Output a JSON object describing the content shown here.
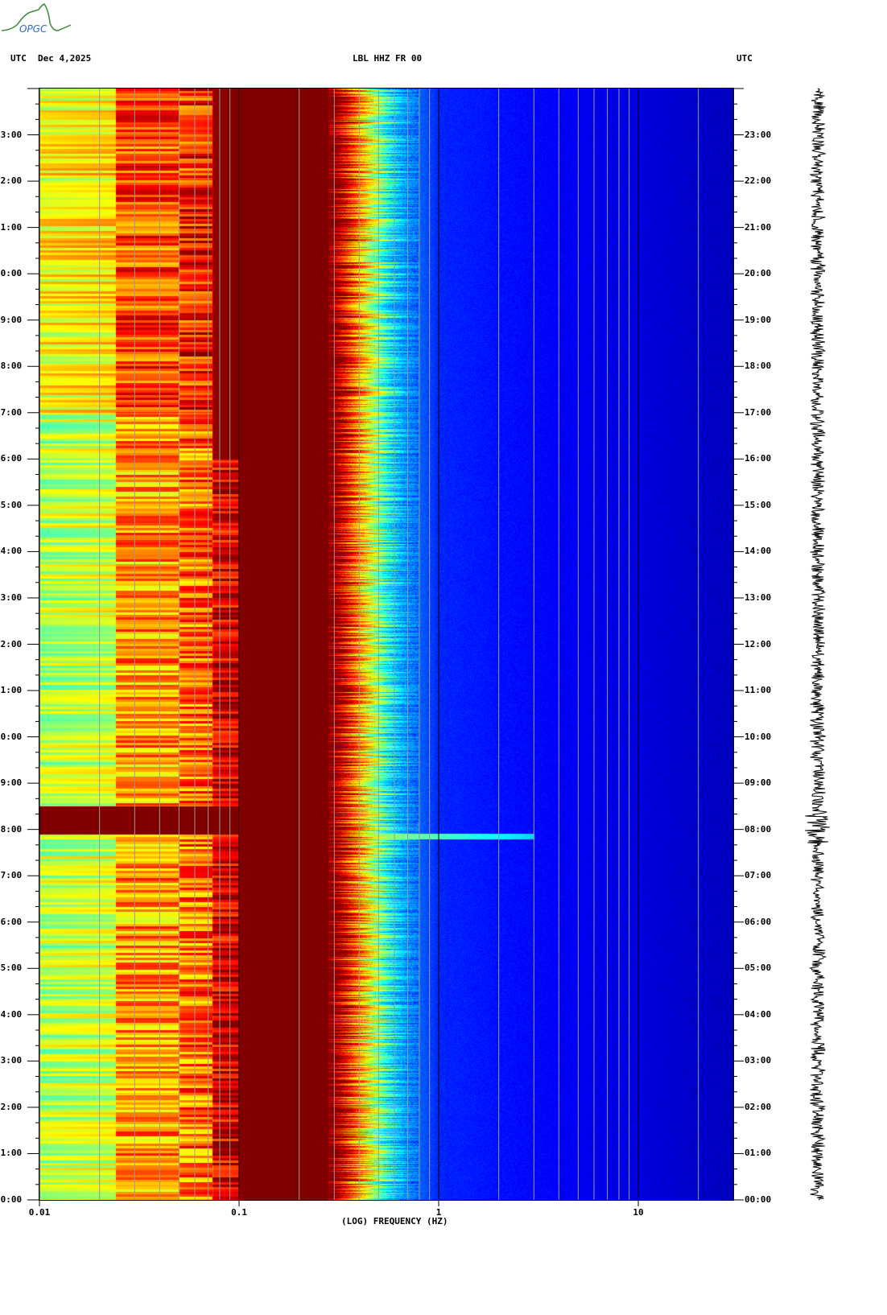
{
  "logo": {
    "text": "OPGC"
  },
  "header": {
    "tz_left": "UTC",
    "date": "Dec 4,2025",
    "station": "LBL HHZ FR 00",
    "tz_right": "UTC"
  },
  "chart_data": {
    "type": "heatmap",
    "title": "LBL HHZ FR 00",
    "xlabel": "(LOG) FREQUENCY (HZ)",
    "xscale": "log",
    "xlim": [
      0.01,
      30
    ],
    "x_ticks": [
      {
        "value": 0.01,
        "label": "0.01"
      },
      {
        "value": 0.1,
        "label": "0.1"
      },
      {
        "value": 1,
        "label": "1"
      },
      {
        "value": 10,
        "label": "10"
      }
    ],
    "ylabel": "UTC",
    "ylim_hours": [
      0,
      24
    ],
    "y_ticks": [
      "00:00",
      "01:00",
      "02:00",
      "03:00",
      "04:00",
      "05:00",
      "06:00",
      "07:00",
      "08:00",
      "09:00",
      "10:00",
      "11:00",
      "12:00",
      "13:00",
      "14:00",
      "15:00",
      "16:00",
      "17:00",
      "18:00",
      "19:00",
      "20:00",
      "21:00",
      "22:00",
      "23:00"
    ],
    "colormap": "jet (blue = low power, dark red = high power)",
    "spectral_profile": [
      {
        "f": 0.01,
        "level": 0.55
      },
      {
        "f": 0.024,
        "level": 0.58
      },
      {
        "f": 0.0241,
        "level": 0.72
      },
      {
        "f": 0.05,
        "level": 0.72
      },
      {
        "f": 0.051,
        "level": 0.76
      },
      {
        "f": 0.073,
        "level": 0.78
      },
      {
        "f": 0.074,
        "level": 0.9
      },
      {
        "f": 0.1,
        "level": 0.92
      },
      {
        "f": 0.101,
        "level": 1.0
      },
      {
        "f": 0.3,
        "level": 1.0
      },
      {
        "f": 0.4,
        "level": 0.7
      },
      {
        "f": 0.6,
        "level": 0.3
      },
      {
        "f": 1.0,
        "level": 0.16
      },
      {
        "f": 30,
        "level": 0.06
      }
    ],
    "events": [
      {
        "start_hour": 7.9,
        "end_hour": 8.5
      }
    ]
  }
}
